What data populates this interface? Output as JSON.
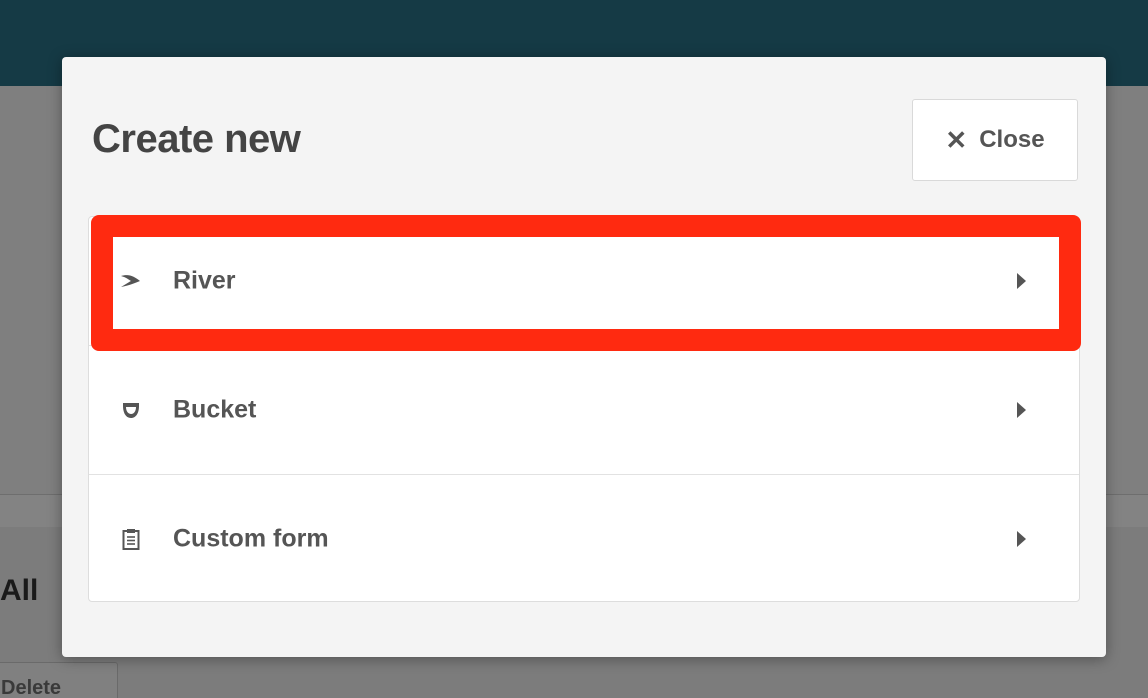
{
  "background": {
    "heading": "All",
    "delete_label": "Delete"
  },
  "modal": {
    "title": "Create new",
    "close_button": {
      "icon": "close-icon",
      "label": "Close"
    },
    "items": [
      {
        "icon": "river-icon",
        "label": "River"
      },
      {
        "icon": "bucket-icon",
        "label": "Bucket"
      },
      {
        "icon": "clipboard-icon",
        "label": "Custom form"
      }
    ]
  },
  "colors": {
    "topbar": "#153a45",
    "highlight": "#ff2a10",
    "text": "#555555",
    "title": "#444444"
  }
}
